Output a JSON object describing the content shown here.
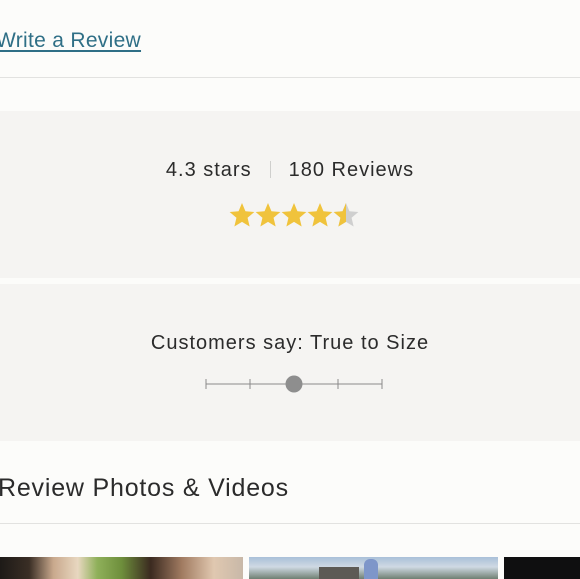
{
  "header": {
    "write_review_label": "Write a Review"
  },
  "summary": {
    "rating_text": "4.3 stars",
    "reviews_text": "180 Reviews",
    "rating_value": 4.3,
    "max_stars": 5,
    "star_color": "#f0c33c",
    "star_empty_color": "#cfcfcf"
  },
  "fit": {
    "label": "Customers say: True to Size",
    "scale_positions": 5,
    "selected_index": 2,
    "marker_color": "#8e8e8e"
  },
  "media": {
    "heading": "Review Photos & Videos"
  },
  "colors": {
    "link": "#2f6f86",
    "panel_bg": "#f5f4f2",
    "page_bg": "#fcfcfa"
  }
}
